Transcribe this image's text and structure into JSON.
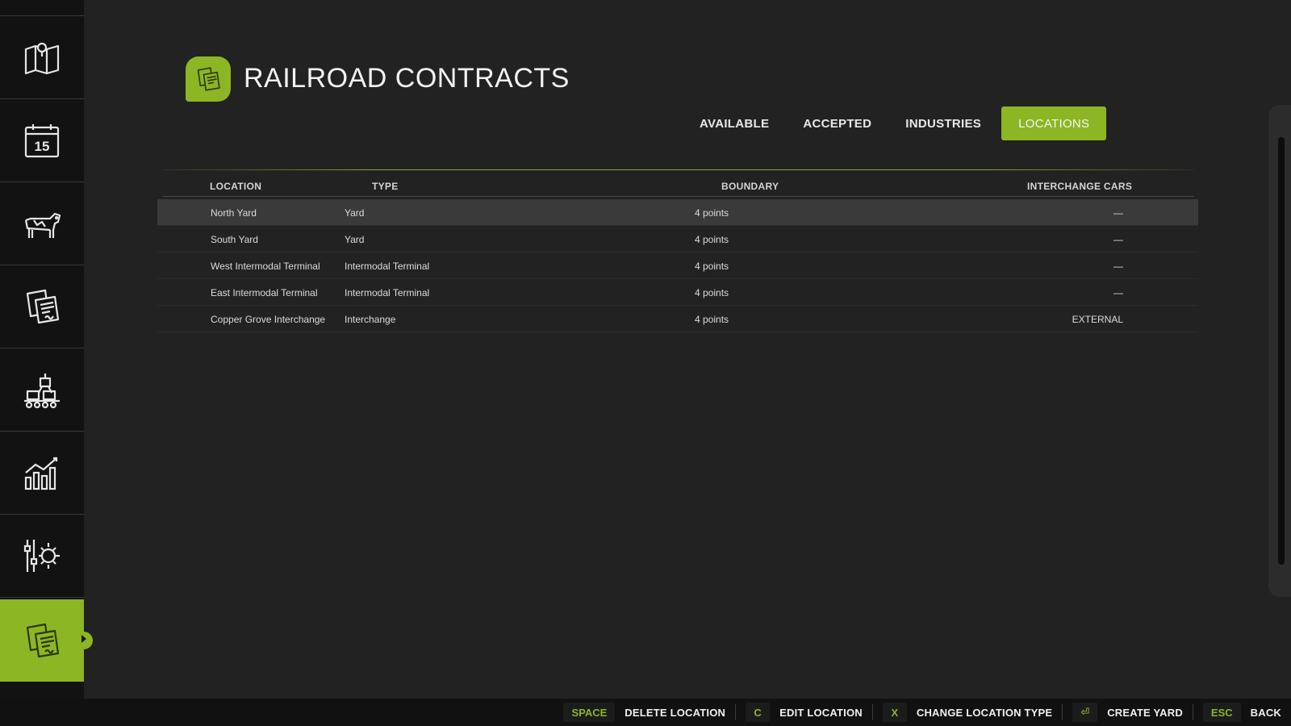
{
  "page": {
    "title": "RAILROAD CONTRACTS",
    "accent_color": "#8cb624"
  },
  "sidebar": {
    "items": [
      {
        "icon": "map-icon"
      },
      {
        "icon": "calendar-icon",
        "label": "15"
      },
      {
        "icon": "cow-icon"
      },
      {
        "icon": "contracts-icon"
      },
      {
        "icon": "production-icon"
      },
      {
        "icon": "statistics-icon"
      },
      {
        "icon": "settings-icon"
      },
      {
        "icon": "railroad-contracts-icon",
        "active": true
      }
    ]
  },
  "tabs": [
    {
      "label": "AVAILABLE"
    },
    {
      "label": "ACCEPTED"
    },
    {
      "label": "INDUSTRIES"
    },
    {
      "label": "LOCATIONS",
      "active": true
    }
  ],
  "table": {
    "headers": {
      "location": "LOCATION",
      "type": "TYPE",
      "boundary": "BOUNDARY",
      "interchange": "INTERCHANGE CARS"
    },
    "rows": [
      {
        "location": "North Yard",
        "type": "Yard",
        "boundary": "4 points",
        "interchange": "—"
      },
      {
        "location": "South Yard",
        "type": "Yard",
        "boundary": "4 points",
        "interchange": "—"
      },
      {
        "location": "West Intermodal Terminal",
        "type": "Intermodal Terminal",
        "boundary": "4 points",
        "interchange": "—"
      },
      {
        "location": "East Intermodal Terminal",
        "type": "Intermodal Terminal",
        "boundary": "4 points",
        "interchange": "—"
      },
      {
        "location": "Copper Grove Interchange",
        "type": "Interchange",
        "boundary": "4 points",
        "interchange": "EXTERNAL"
      }
    ]
  },
  "footer": {
    "hints": [
      {
        "key": "SPACE",
        "label": "DELETE LOCATION"
      },
      {
        "key": "C",
        "label": "EDIT LOCATION"
      },
      {
        "key": "X",
        "label": "CHANGE LOCATION TYPE"
      },
      {
        "key": "⏎",
        "label": "CREATE YARD"
      },
      {
        "key": "ESC",
        "label": "BACK"
      }
    ]
  }
}
